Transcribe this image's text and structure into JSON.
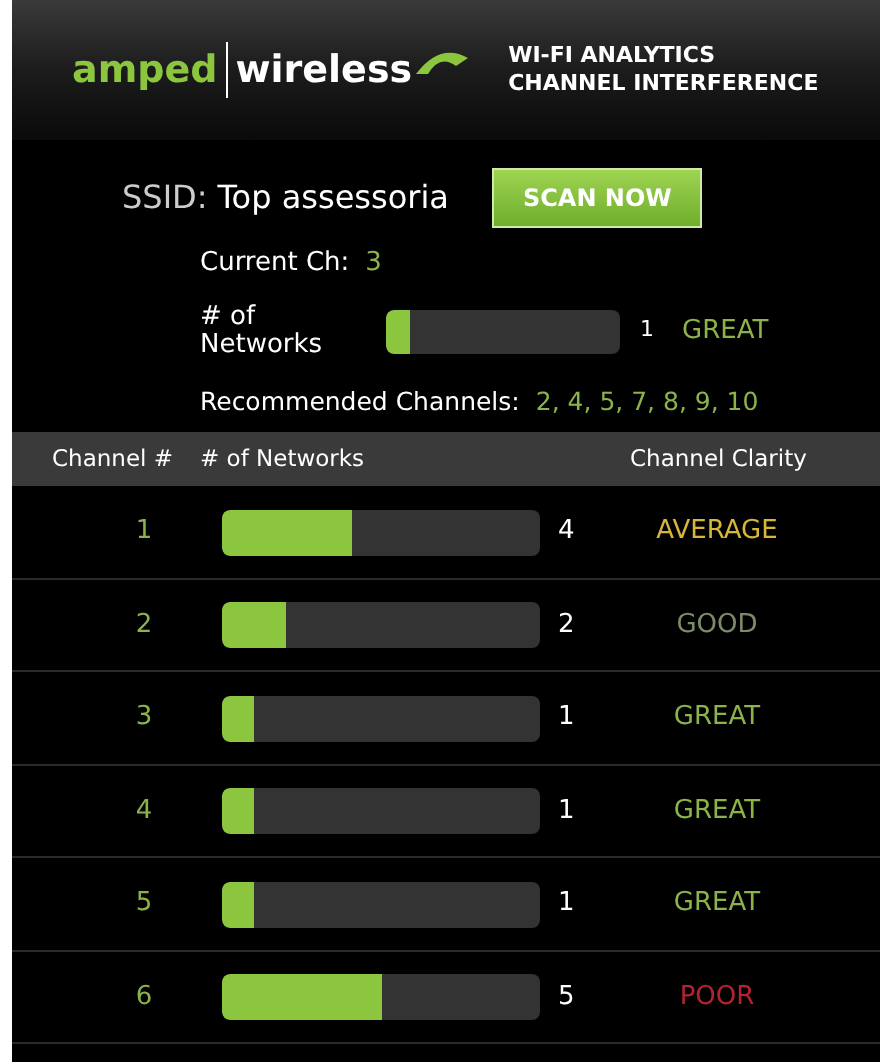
{
  "header": {
    "logo_left": "amped",
    "logo_right": "wireless",
    "title_lines": [
      "WI-FI ANALYTICS",
      "CHANNEL INTERFERENCE"
    ]
  },
  "ssid": {
    "label": "SSID:",
    "value": "Top assessoria"
  },
  "scan_button": "SCAN NOW",
  "current_channel": {
    "label": "Current Ch:",
    "value": "3"
  },
  "networks": {
    "label": "# of Networks",
    "level": 0.1,
    "count": "1",
    "clarity": "GREAT",
    "color": "#8cb34a"
  },
  "recommended": {
    "label": "Recommended Channels:",
    "value": "2, 4, 5, 7, 8, 9, 10"
  },
  "table": {
    "columns": [
      "Channel #",
      "# of Networks",
      "Channel Clarity"
    ],
    "rows": [
      {
        "channel": "1",
        "level": 0.41,
        "count": "4",
        "clarity": "AVERAGE",
        "color": "#d6b73c"
      },
      {
        "channel": "2",
        "level": 0.2,
        "count": "2",
        "clarity": "GOOD",
        "color": "#7b8a68"
      },
      {
        "channel": "3",
        "level": 0.1,
        "count": "1",
        "clarity": "GREAT",
        "color": "#8cb34a"
      },
      {
        "channel": "4",
        "level": 0.1,
        "count": "1",
        "clarity": "GREAT",
        "color": "#8cb34a"
      },
      {
        "channel": "5",
        "level": 0.1,
        "count": "1",
        "clarity": "GREAT",
        "color": "#8cb34a"
      },
      {
        "channel": "6",
        "level": 0.5,
        "count": "5",
        "clarity": "POOR",
        "color": "#b0232f"
      }
    ]
  }
}
